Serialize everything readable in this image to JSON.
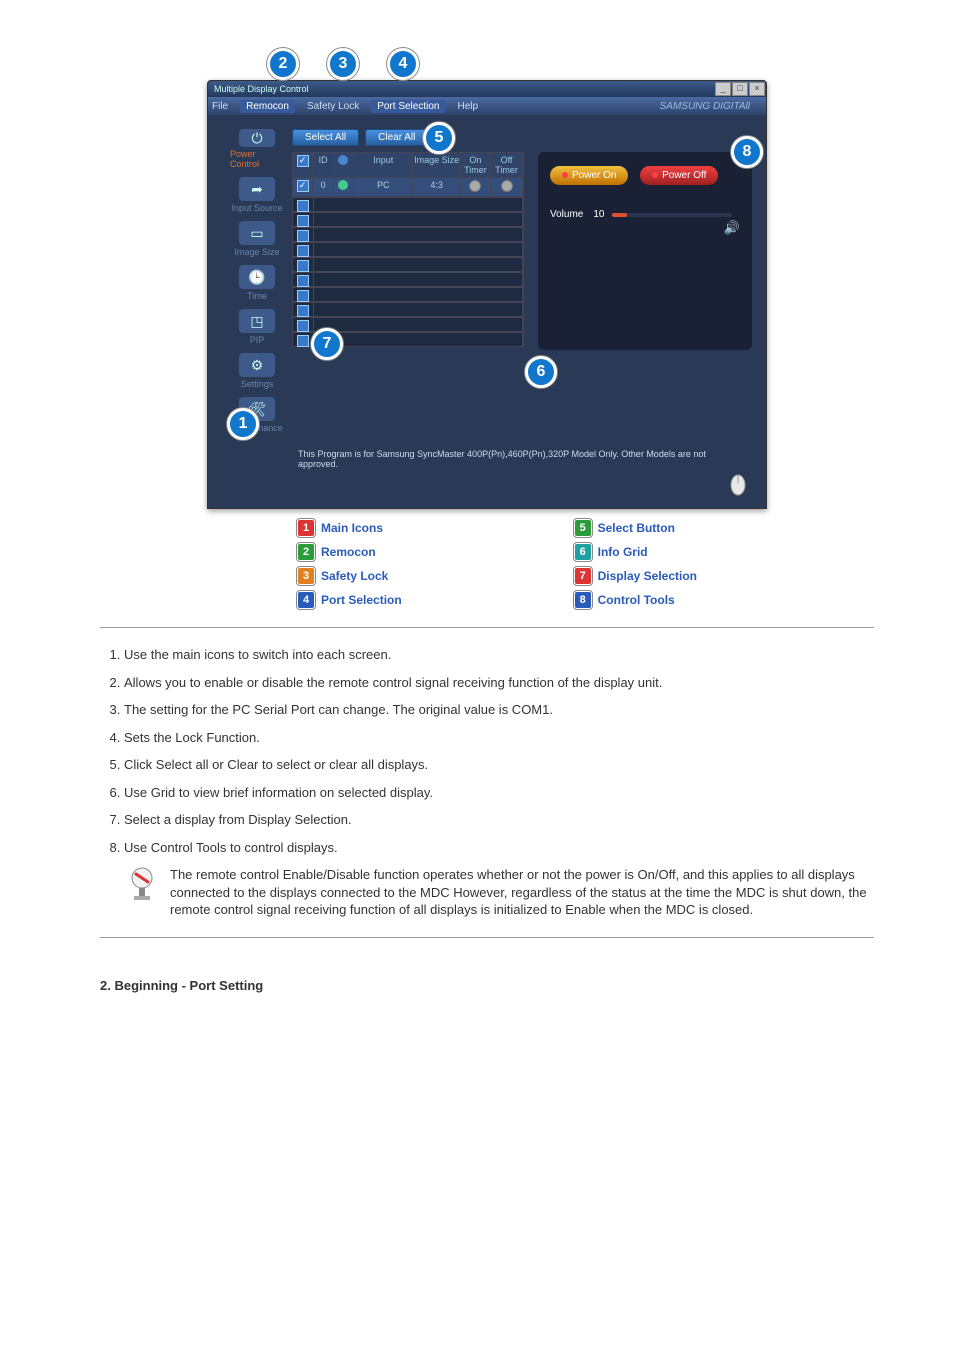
{
  "app": {
    "title": "Multiple Display Control",
    "brand": "SAMSUNG DIGITAll",
    "menu": {
      "file": "File",
      "remocon": "Remocon",
      "safety_lock": "Safety Lock",
      "port_selection": "Port Selection",
      "help": "Help"
    },
    "sidebar": {
      "power_control": "Power Control",
      "input_source": "Input Source",
      "image_size": "Image Size",
      "time": "Time",
      "pip": "PIP",
      "settings": "Settings",
      "maintenance": "Maintenance"
    },
    "select_all": "Select All",
    "clear_all": "Clear All",
    "grid_headers": {
      "chk": "",
      "id": "ID",
      "status": "",
      "input": "Input",
      "image_size": "Image Size",
      "on_timer": "On Timer",
      "off_timer": "Off Timer"
    },
    "grid_row": {
      "id": "0",
      "input": "PC",
      "image_size": "4:3"
    },
    "power_on": "Power On",
    "power_off": "Power Off",
    "volume_label": "Volume",
    "volume_value": "10",
    "status_msg": "This Program is for Samsung SyncMaster 400P(Pn),460P(Pn),320P  Model Only. Other Models are not approved."
  },
  "legend": {
    "1": "Main Icons",
    "2": "Remocon",
    "3": "Safety Lock",
    "4": "Port Selection",
    "5": "Select Button",
    "6": "Info Grid",
    "7": "Display Selection",
    "8": "Control Tools"
  },
  "descriptions": {
    "1": "Use the main icons to switch into each screen.",
    "2": "Allows you to enable or disable the remote control signal receiving function of the display unit.",
    "3": "The setting for the PC Serial Port can change. The original value is COM1.",
    "4": "Sets the Lock Function.",
    "5": "Click Select all or Clear to select or clear all displays.",
    "6": "Use Grid to view brief information on selected display.",
    "7": "Select a display from Display Selection.",
    "8": "Use Control Tools to control displays."
  },
  "note": "The remote control Enable/Disable function operates whether or not the power is On/Off, and this applies to all displays connected to the displays connected to the MDC However, regardless of the status at the time the MDC is shut down, the remote control signal receiving function of all displays is initialized to Enable when the MDC is closed.",
  "next_section": "2. Beginning - Port Setting"
}
